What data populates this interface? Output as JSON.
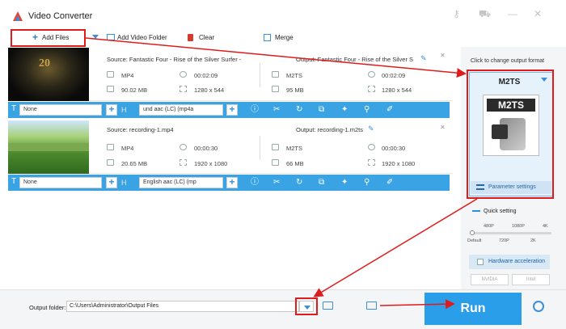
{
  "app": {
    "title": "Video Converter"
  },
  "toolbar": {
    "add_files": "Add Files",
    "add_video_folder": "Add Video Folder",
    "clear": "Clear",
    "merge": "Merge"
  },
  "files": [
    {
      "source_title": "Source: Fantastic Four - Rise of the Silver Surfer -",
      "source_format": "MP4",
      "source_duration": "00:02:09",
      "source_size": "90.02 MB",
      "source_resolution": "1280 x 544",
      "output_title": "Output: Fantastic Four - Rise of the Silver S",
      "output_format": "M2TS",
      "output_duration": "00:02:09",
      "output_size": "95 MB",
      "output_resolution": "1280 x 544",
      "subtitle": "None",
      "audio": "und aac (LC) (mp4a"
    },
    {
      "source_title": "Source: recording-1.mp4",
      "source_format": "MP4",
      "source_duration": "00:00:30",
      "source_size": "20.65 MB",
      "source_resolution": "1920 x 1080",
      "output_title": "Output: recording-1.m2ts",
      "output_format": "M2TS",
      "output_duration": "00:00:30",
      "output_size": "66 MB",
      "output_resolution": "1920 x 1080",
      "subtitle": "None",
      "audio": "English aac (LC) (mp"
    }
  ],
  "right_panel": {
    "click_label": "Click to change output format",
    "format_name": "M2TS",
    "format_icon_text": "M2TS",
    "parameter_settings": "Parameter settings",
    "quick_setting": "Quick setting",
    "quality_top": [
      "480P",
      "1080P",
      "4K"
    ],
    "quality_bottom": [
      "Default",
      "720P",
      "2K"
    ],
    "hardware_acceleration": "Hardware acceleration",
    "vendors": [
      "NVIDIA",
      "Intel"
    ]
  },
  "bottom": {
    "output_folder_label": "Output folder:",
    "output_folder_value": "C:\\Users\\Administrator\\Output Files",
    "run_label": "Run"
  },
  "colors": {
    "accent": "#3aa3e3",
    "annotation": "#e01b1b",
    "run": "#2a9ee8"
  }
}
